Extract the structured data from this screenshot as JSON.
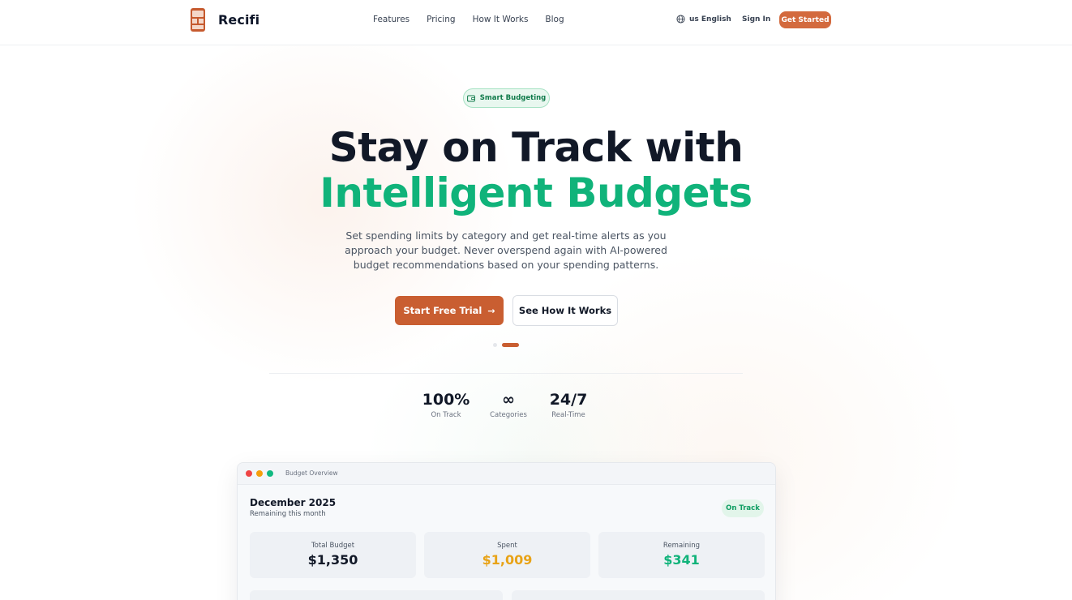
{
  "brand": {
    "name": "Recifi",
    "accent": "#c95e31",
    "green": "#10b37a"
  },
  "nav": {
    "links": [
      "Features",
      "Pricing",
      "How It Works",
      "Blog"
    ],
    "language": "us English",
    "sign_in": "Sign In",
    "get_started": "Get Started"
  },
  "hero": {
    "badge": "Smart Budgeting",
    "title_line1": "Stay on Track with",
    "title_line2": "Intelligent Budgets",
    "subtitle": "Set spending limits by category and get real-time alerts as you approach your budget. Never overspend again with AI-powered budget recommendations based on your spending patterns.",
    "primary_cta": "Start Free Trial",
    "secondary_cta": "See How It Works"
  },
  "stats": [
    {
      "value": "100%",
      "label": "On Track"
    },
    {
      "value": "∞",
      "label": "Categories"
    },
    {
      "value": "24/7",
      "label": "Real-Time"
    }
  ],
  "preview": {
    "window_title": "Budget Overview",
    "month": "December 2025",
    "remaining_caption": "Remaining this month",
    "status": "On Track",
    "cards": [
      {
        "label": "Total Budget",
        "value": "$1,350",
        "color": "#111827"
      },
      {
        "label": "Spent",
        "value": "$1,009",
        "color": "#e8a317"
      },
      {
        "label": "Remaining",
        "value": "$341",
        "color": "#10b37a"
      }
    ]
  }
}
